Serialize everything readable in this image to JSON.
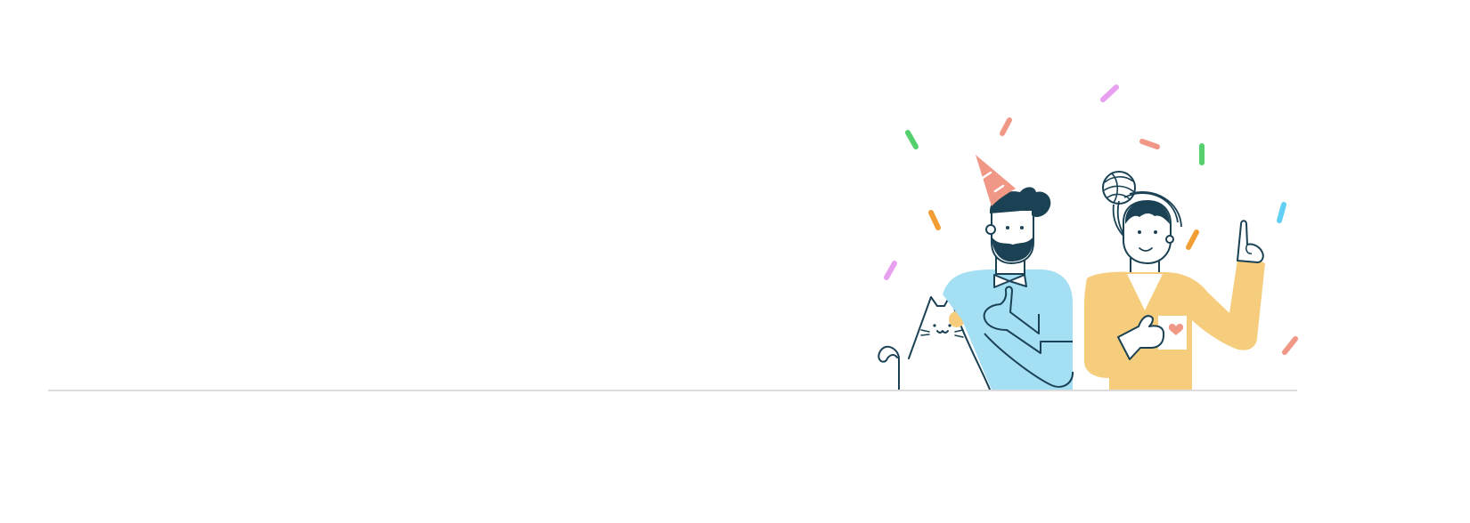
{
  "colors": {
    "background": "#ffffff",
    "outline": "#1b4254",
    "shirt_blue": "#a5dff4",
    "sweater_yellow": "#f5cd7d",
    "hat_salmon": "#f19785",
    "heart": "#f19785",
    "baseline": "#dcdcdc",
    "confetti_green": "#55d06d",
    "confetti_violet": "#e7a0f0",
    "confetti_orange": "#f29e35",
    "confetti_cyan": "#60d0f4",
    "confetti_salmon": "#f19785"
  },
  "illustration": {
    "description_icon": "celebration-illustration-icon",
    "confetti_colors": [
      "green",
      "violet",
      "salmon",
      "orange",
      "cyan"
    ]
  }
}
